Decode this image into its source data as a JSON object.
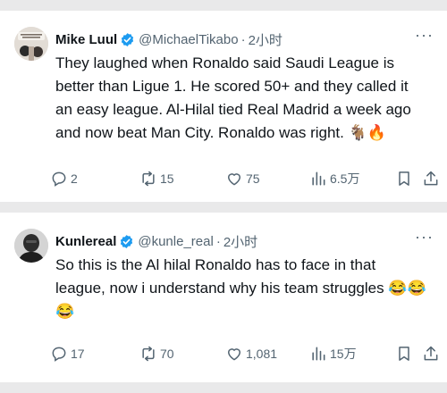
{
  "tweets": [
    {
      "author_name": "Mike Luul",
      "handle": "@MichaelTikabo",
      "separator": "·",
      "time": "2小时",
      "more_label": "···",
      "text": "They laughed when Ronaldo said Saudi League is better than Ligue 1. He scored 50+ and they called it an easy league. Al-Hilal tied Real Madrid a week ago and now beat Man City. Ronaldo was right. 🐐🔥",
      "replies": "2",
      "retweets": "15",
      "likes": "75",
      "views": "6.5万",
      "icons": [
        "verified-badge-icon",
        "reply-icon",
        "retweet-icon",
        "heart-icon",
        "views-chart-icon",
        "bookmark-icon",
        "share-icon",
        "more-icon"
      ]
    },
    {
      "author_name": "Kunlereal",
      "handle": "@kunle_real",
      "separator": "·",
      "time": "2小时",
      "more_label": "···",
      "text": "So this is the Al hilal Ronaldo has to face in that league, now i understand why his team struggles 😂😂😂",
      "replies": "17",
      "retweets": "70",
      "likes": "1,081",
      "views": "15万",
      "icons": [
        "verified-badge-icon",
        "reply-icon",
        "retweet-icon",
        "heart-icon",
        "views-chart-icon",
        "bookmark-icon",
        "share-icon",
        "more-icon"
      ]
    }
  ],
  "colors": {
    "verified": "#1d9bf0",
    "secondary_text": "#536471",
    "primary_text": "#0f1419",
    "background": "#ffffff",
    "separator": "#e9e9ea"
  }
}
